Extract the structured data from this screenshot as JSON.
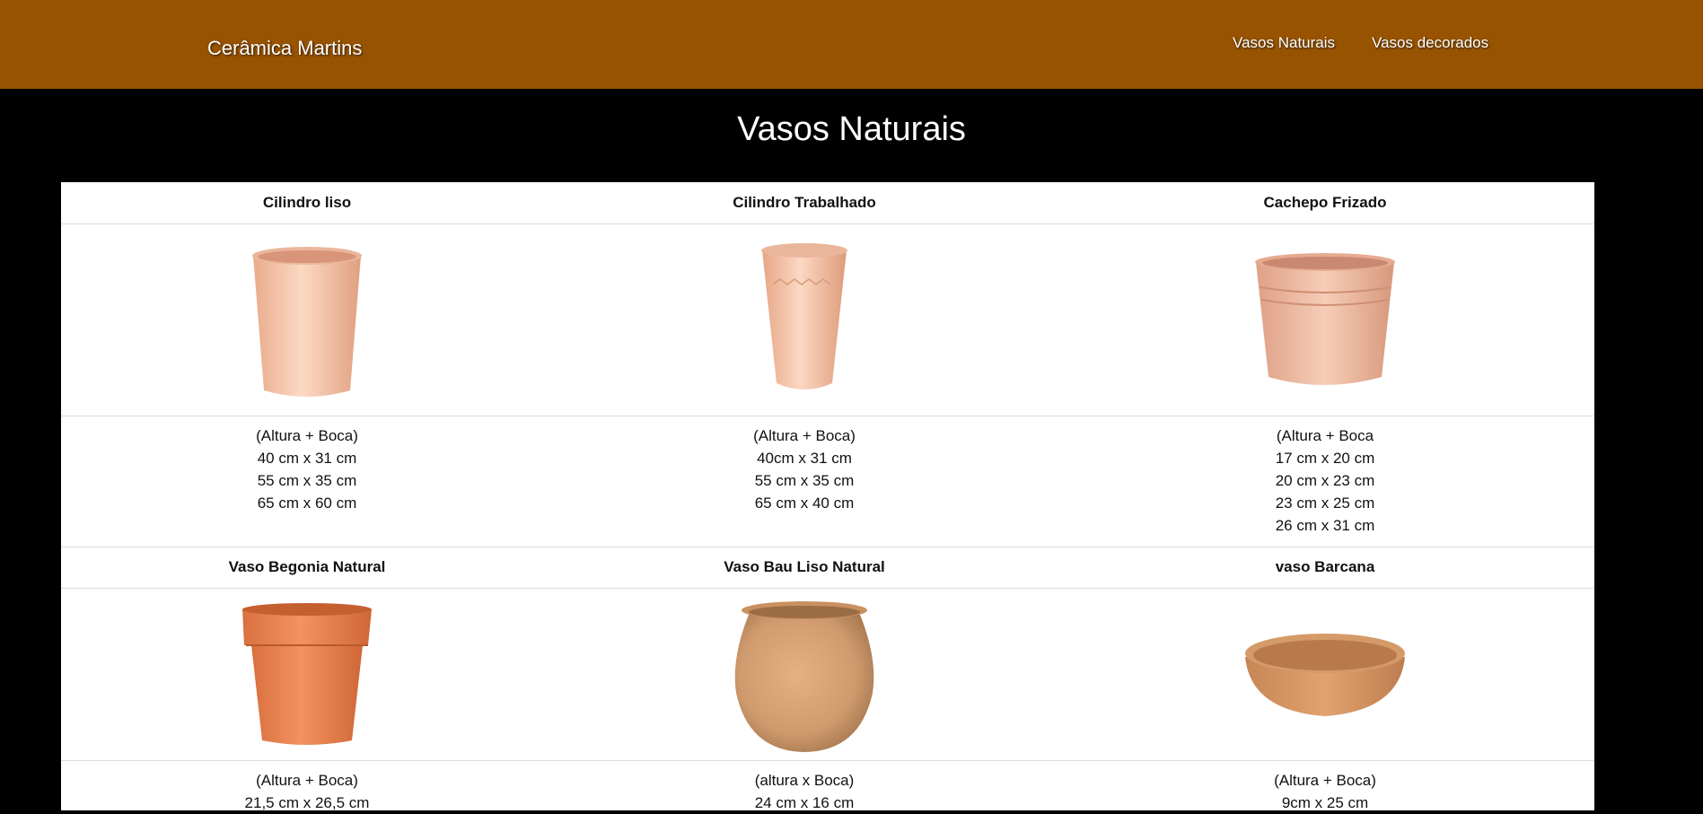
{
  "navbar": {
    "brand": "Cerâmica Martins",
    "links": [
      "Vasos Naturais",
      "Vasos decorados"
    ]
  },
  "page": {
    "title": "Vasos Naturais"
  },
  "products": [
    {
      "name": "Cilindro liso",
      "icon": "cylinder-pot-photo",
      "dimensions": [
        "(Altura + Boca)",
        "40 cm x 31 cm",
        "55 cm x 35 cm",
        "65 cm x 60 cm"
      ]
    },
    {
      "name": "Cilindro Trabalhado",
      "icon": "carved-cylinder-pot-photo",
      "dimensions": [
        "(Altura + Boca)",
        "40cm x 31 cm",
        "55 cm x 35 cm",
        "65 cm x 40 cm"
      ]
    },
    {
      "name": "Cachepo Frizado",
      "icon": "ridged-cachepot-photo",
      "dimensions": [
        "(Altura + Boca",
        "17 cm x 20 cm",
        "20 cm x 23 cm",
        "23 cm x 25 cm",
        "26 cm x 31 cm"
      ]
    },
    {
      "name": "Vaso Begonia Natural",
      "icon": "begonia-pot-photo",
      "dimensions": [
        "(Altura + Boca)",
        "21,5 cm x 26,5 cm"
      ]
    },
    {
      "name": "Vaso Bau Liso Natural",
      "icon": "round-bau-pot-photo",
      "dimensions": [
        "(altura x Boca)",
        "24 cm x 16 cm"
      ]
    },
    {
      "name": "vaso Barcana",
      "icon": "shallow-bowl-pot-photo",
      "dimensions": [
        "(Altura + Boca)",
        "9cm x 25 cm"
      ]
    }
  ],
  "colors": {
    "navbar": "#975300",
    "page_background": "#000000",
    "catalog_background": "#ffffff"
  }
}
